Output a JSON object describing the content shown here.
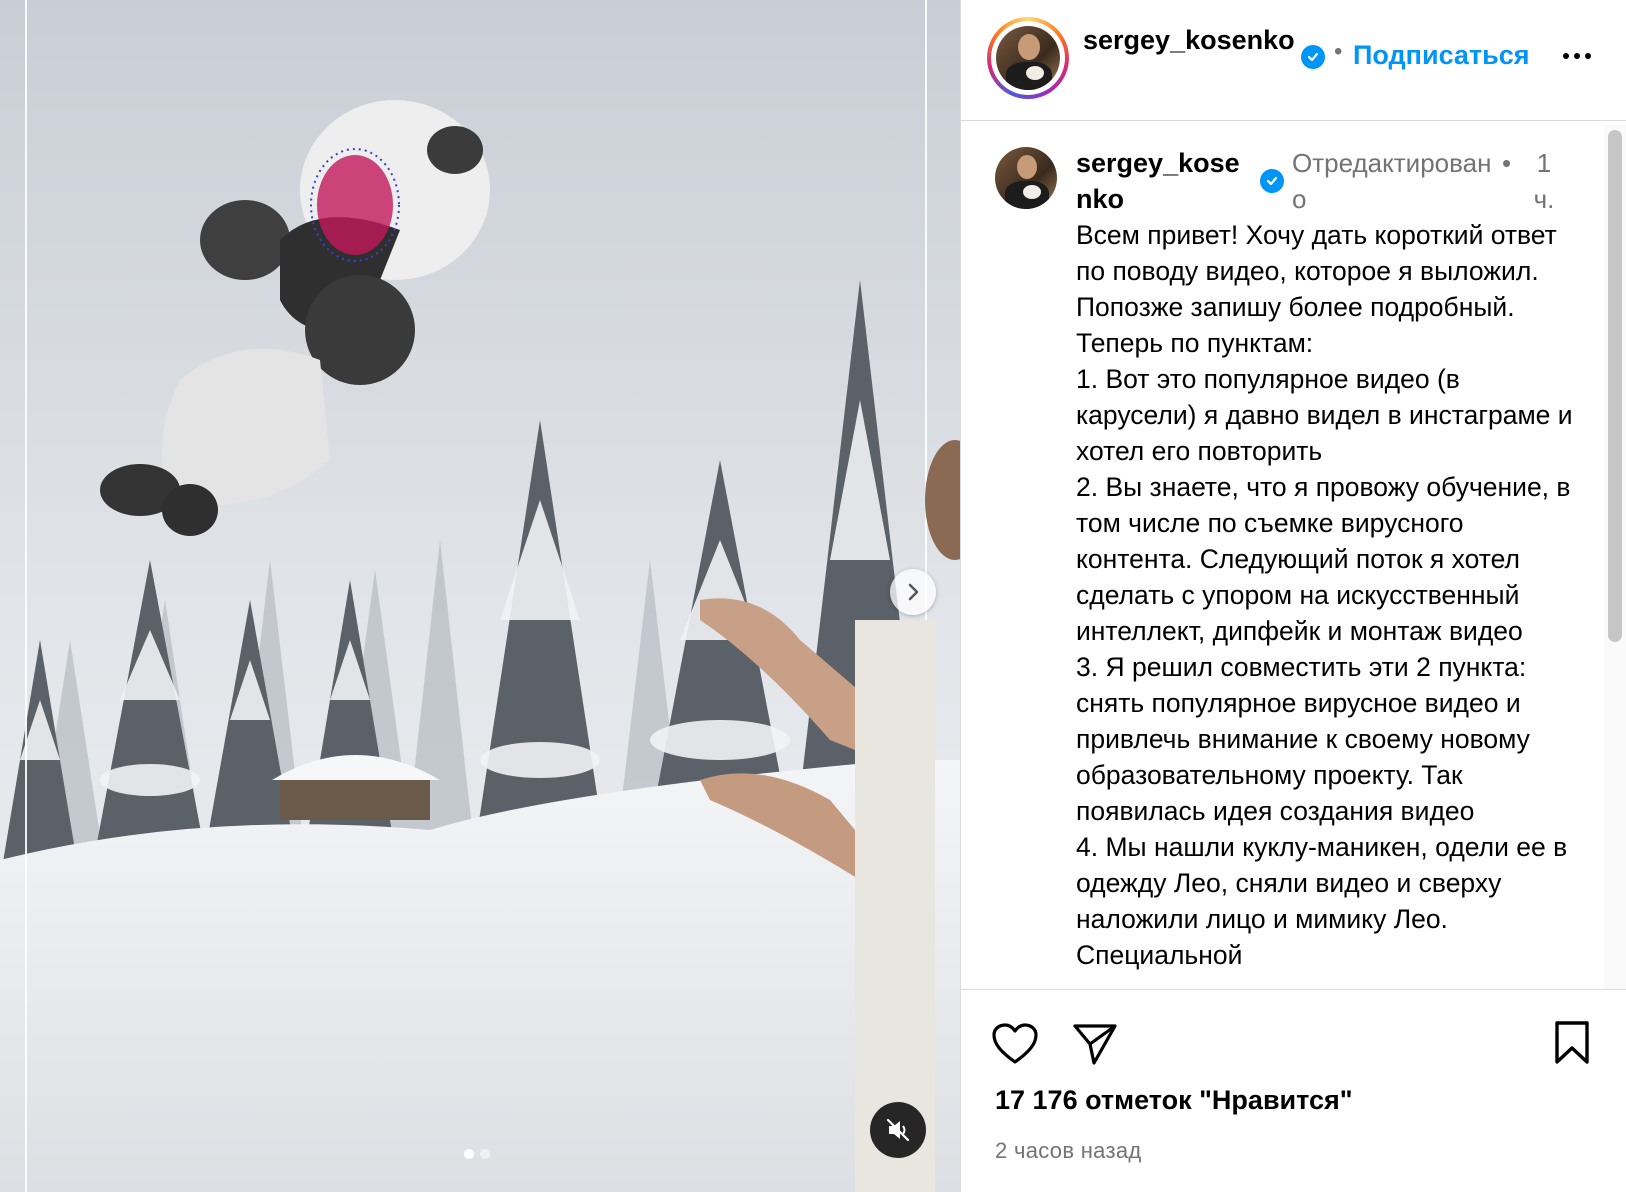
{
  "post": {
    "author": "sergey_kosenko",
    "follow_label": "Подписаться",
    "separator": "•",
    "verified_icon": "verified-badge-icon",
    "more_icon": "more-options-icon"
  },
  "media": {
    "carousel_dots": 2,
    "active_dot": 1,
    "next_icon": "chevron-right-icon",
    "mute_icon": "speaker-muted-icon"
  },
  "comment": {
    "username": "sergey_kosenko",
    "edited_label": "Отредактировано",
    "separator": "•",
    "time": "1 ч.",
    "text": "Всем привет! Хочу дать короткий ответ по поводу видео, которое я выложил. Попозже запишу более подробный. Теперь по пунктам:\n1. Вот это популярное видео (в карусели) я давно видел в инстаграме и хотел его повторить\n2. Вы знаете, что я провожу обучение, в том числе по съемке вирусного контента. Следующий поток я хотел сделать с упором на искусственный интеллект, дипфейк и монтаж видео\n3. Я решил совместить эти 2 пункта: снять популярное вирусное видео и привлечь внимание к своему новому образовательному проекту. Так появилась идея создания видео\n4. Мы нашли куклу-маникен, одели ее в одежду Лео, сняли видео и сверху наложили лицо и мимику Лео. Специальной"
  },
  "actions": {
    "like_icon": "heart-icon",
    "share_icon": "send-icon",
    "save_icon": "bookmark-icon",
    "likes_text": "17 176 отметок \"Нравится\"",
    "posted_ago": "2 часов назад"
  },
  "colors": {
    "accent": "#0095f6",
    "secondary_text": "#737373",
    "border": "#dbdbdb"
  }
}
